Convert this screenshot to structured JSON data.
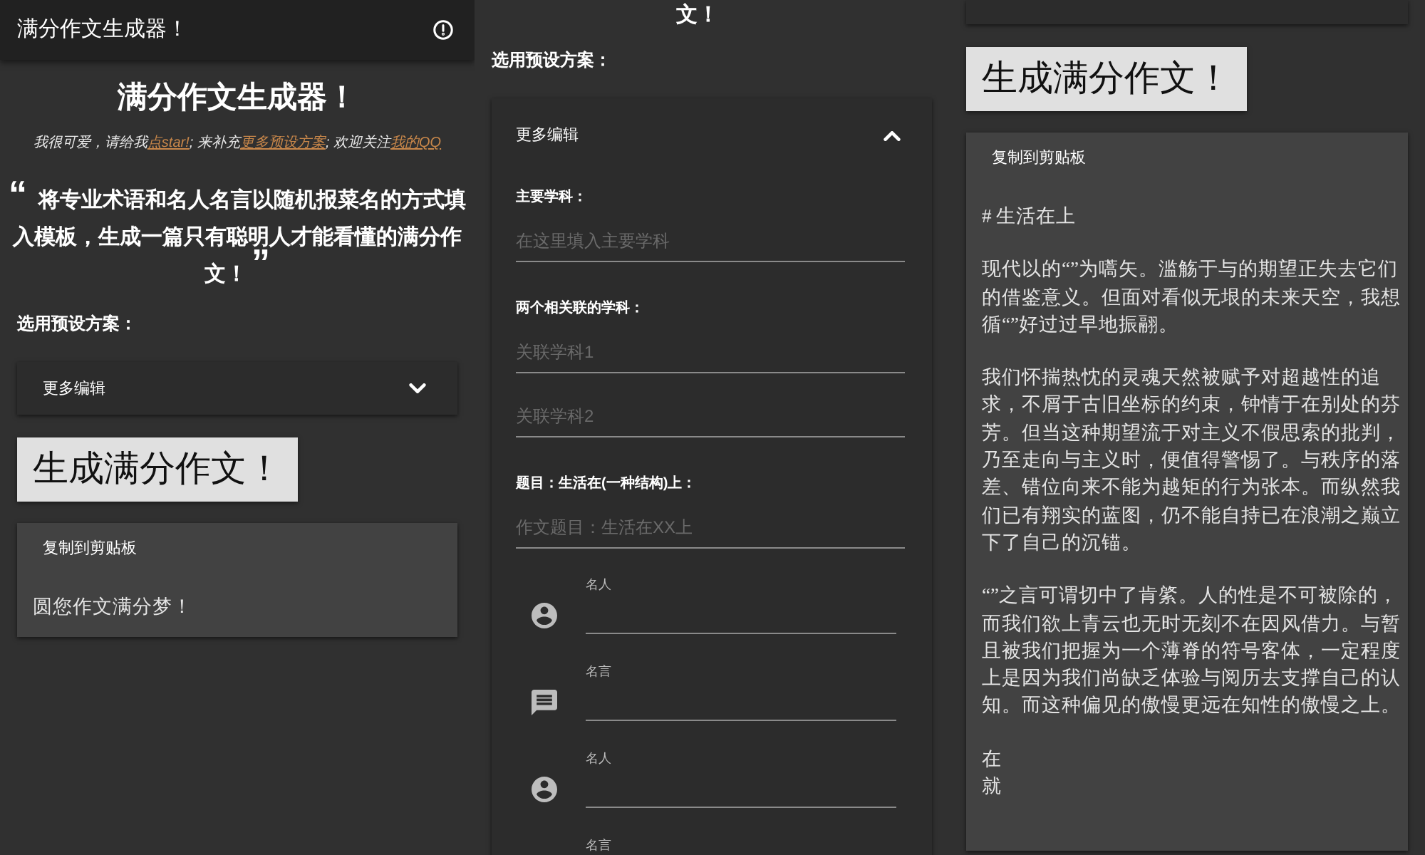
{
  "screens": [
    {
      "app_bar": {
        "title": "满分作文生成器！"
      },
      "heading": "满分作文生成器！",
      "subtitle": [
        {
          "kind": "text",
          "text": "我很可爱，请给我"
        },
        {
          "kind": "link",
          "text": "点star!"
        },
        {
          "kind": "text",
          "text": "; 来补充"
        },
        {
          "kind": "link",
          "text": "更多预设方案"
        },
        {
          "kind": "text",
          "text": "; 欢迎关注"
        },
        {
          "kind": "link",
          "text": "我的QQ"
        }
      ],
      "quote": {
        "open": "“",
        "text": "将专业术语和名人名言以随机报菜名的方式填入模板，生成一篇只有聪明人才能看懂的满分作文！",
        "close": "”"
      },
      "preset_label": "选用预设方案：",
      "preset_panel": {
        "kind": "full",
        "title": "更多编辑",
        "expanded": false
      },
      "generate_button": "生成满分作文！",
      "output_card": {
        "copy_button": "复制到剪贴板",
        "paragraphs": [
          "圆您作文满分梦！"
        ]
      }
    },
    {
      "quote_tail": "文！",
      "preset_label": "选用预设方案：",
      "preset_panel": {
        "kind": "full",
        "title": "更多编辑",
        "expanded": true,
        "sections": [
          {
            "label": "主要学科：",
            "fields": [
              {
                "placeholder": "在这里填入主要学科"
              }
            ]
          },
          {
            "label": "两个相关联的学科：",
            "fields": [
              {
                "placeholder": "关联学科1"
              },
              {
                "placeholder": "关联学科2"
              }
            ]
          },
          {
            "label": "题目：生活在(一种结构)上：",
            "fields": [
              {
                "placeholder": "作文题目：生活在XX上"
              }
            ]
          }
        ],
        "entries": [
          {
            "kind": "person",
            "label": "名人"
          },
          {
            "kind": "quote",
            "label": "名言"
          },
          {
            "kind": "person",
            "label": "名人"
          },
          {
            "kind": "quote",
            "label": "名言"
          }
        ]
      }
    },
    {
      "preset_panel": {
        "kind": "edge"
      },
      "generate_button": "生成满分作文！",
      "output_card": {
        "copy_button": "复制到剪贴板",
        "paragraphs": [
          "# 生活在上",
          "现代以的“”为嚆矢。滥觞于与的期望正失去它们的借鉴意义。但面对看似无垠的未来天空，我想循“”好过过早地振翮。",
          "我们怀揣热忱的灵魂天然被赋予对超越性的追求，不屑于古旧坐标的约束，钟情于在别处的芬芳。但当这种期望流于对主义不假思索的批判，乃至走向与主义时，便值得警惕了。与秩序的落差、错位向来不能为越矩的行为张本。而纵然我们已有翔实的蓝图，仍不能自持已在浪潮之巅立下了自己的沉锚。",
          "“”之言可谓切中了肯綮。人的性是不可被除的，而我们欲上青云也无时无刻不在因风借力。与暂且被我们把握为一个薄脊的符号客体，一定程度上是因为我们尚缺乏体验与阅历去支撑自己的认知。而这种偏见的傲慢更远在知性的傲慢之上。"
        ],
        "covered_lines": [
          "在",
          "就"
        ]
      }
    }
  ]
}
